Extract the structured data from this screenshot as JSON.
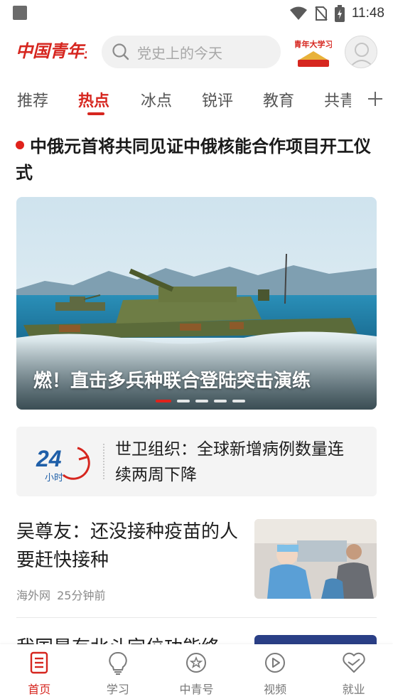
{
  "status_bar": {
    "time": "11:48",
    "icons": [
      "notification-square-icon",
      "wifi-icon",
      "no-sim-icon",
      "battery-charging-icon"
    ]
  },
  "header": {
    "logo_text": "中国青年报",
    "search_placeholder": "党史上的今天",
    "study_badge_text": "青年大学习",
    "avatar": "user-avatar-icon"
  },
  "tabs": {
    "items": [
      "推荐",
      "热点",
      "冰点",
      "锐评",
      "教育",
      "共青"
    ],
    "active_index": 1,
    "add_icon": "plus-icon"
  },
  "headline": {
    "text": "中俄元首将共同见证中俄核能合作项目开工仪式"
  },
  "banner": {
    "caption": "燃！直击多兵种联合登陆突击演练",
    "slide_count": 5,
    "active_slide": 0
  },
  "card24": {
    "badge_number": "24",
    "badge_unit": "小时",
    "text": "世卫组织：全球新增病例数量连续两周下降"
  },
  "news": [
    {
      "title": "吴尊友：还没接种疫苗的人要赶快接种",
      "source": "海外网",
      "time": "25分钟前"
    },
    {
      "title": "我国是有北斗定位功能终"
    }
  ],
  "bottom_nav": {
    "items": [
      {
        "label": "首页",
        "icon": "home-doc-icon",
        "active": true
      },
      {
        "label": "学习",
        "icon": "bulb-icon",
        "active": false
      },
      {
        "label": "中青号",
        "icon": "star-circle-icon",
        "active": false
      },
      {
        "label": "视频",
        "icon": "play-circle-icon",
        "active": false
      },
      {
        "label": "就业",
        "icon": "heart-icon",
        "active": false
      }
    ]
  },
  "colors": {
    "brand_red": "#d6261f",
    "search_bg": "#f1f1f1",
    "card_bg": "#f4f4f4",
    "text_dark": "#1d1d1d",
    "meta_gray": "#8a8a8a"
  }
}
